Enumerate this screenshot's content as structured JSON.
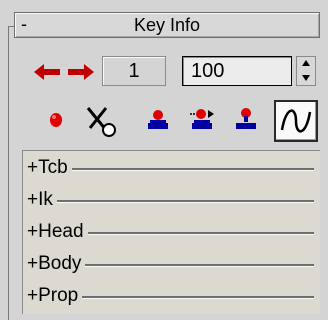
{
  "rollout": {
    "collapse_symbol": "-",
    "title": "Key Info"
  },
  "key_nav": {
    "prev_icon": "arrow-left-icon",
    "next_icon": "arrow-right-icon",
    "key_number": "1",
    "time_value": "100",
    "arrow_color": "#c00000"
  },
  "tools": [
    {
      "icon": "red-dot-icon"
    },
    {
      "icon": "scissors-icon"
    },
    {
      "icon": "set-key-icon"
    },
    {
      "icon": "move-key-icon"
    },
    {
      "icon": "key-marker-icon"
    },
    {
      "icon": "curve-icon"
    }
  ],
  "list": {
    "items": [
      {
        "label": "+Tcb"
      },
      {
        "label": "+Ik"
      },
      {
        "label": "+Head"
      },
      {
        "label": "+Body"
      },
      {
        "label": "+Prop"
      }
    ]
  },
  "colors": {
    "panel_bg": "#d4d4d4",
    "list_bg": "#dcd9d0",
    "icon_red": "#e00000",
    "icon_blue": "#0000a0"
  }
}
